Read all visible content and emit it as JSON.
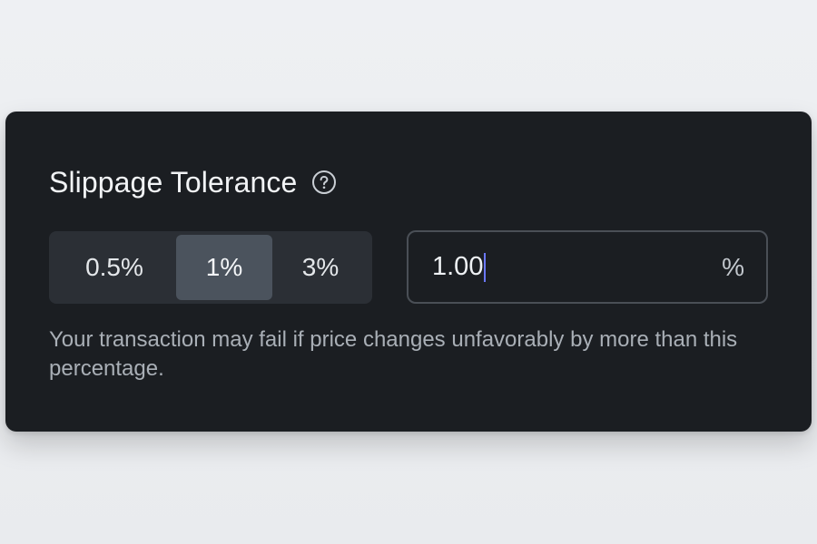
{
  "panel": {
    "title": "Slippage Tolerance",
    "help_icon": "question-circle-icon",
    "presets": [
      {
        "label": "0.5%",
        "selected": false
      },
      {
        "label": "1%",
        "selected": true
      },
      {
        "label": "3%",
        "selected": false
      }
    ],
    "custom_input": {
      "value": "1.00",
      "unit": "%"
    },
    "description": "Your transaction may fail if price changes unfavorably by more than this percentage."
  },
  "colors": {
    "background": "#eceef1",
    "card": "#1b1e22",
    "segment_bg": "#2b2f35",
    "segment_active": "#4b535d",
    "caret": "#6b78ff"
  }
}
